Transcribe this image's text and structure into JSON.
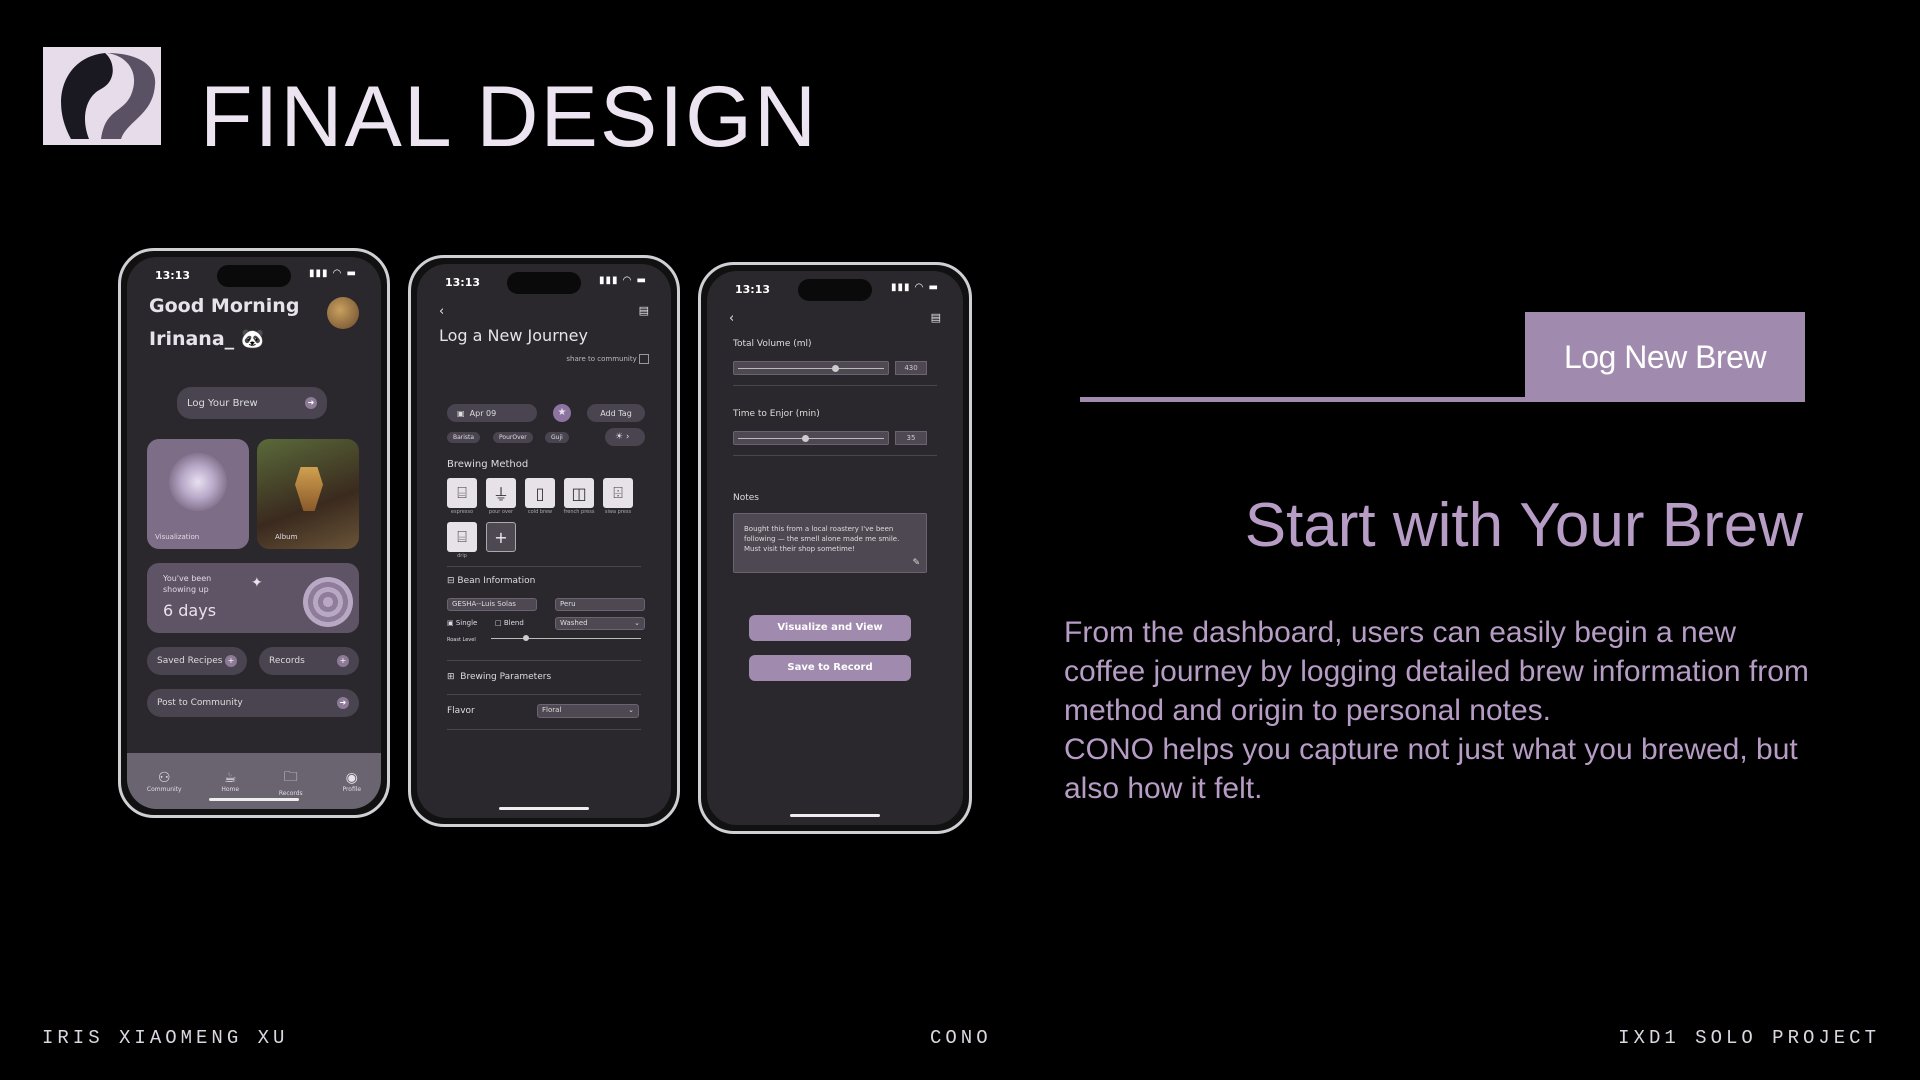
{
  "header": {
    "title": "FINAL DESIGN"
  },
  "phone1": {
    "time": "13:13",
    "greeting_line1": "Good Morning",
    "greeting_line2": "Irinana_",
    "log_button": "Log Your Brew",
    "card_visualization": "Visualization",
    "card_album": "Album",
    "streak_label": "You've been showing up",
    "streak_value": "6 days",
    "saved_recipes": "Saved Recipes",
    "records": "Records",
    "post_community": "Post to Community",
    "nav": [
      "Community",
      "Home",
      "Records",
      "Profile"
    ]
  },
  "phone2": {
    "time": "13:13",
    "title": "Log a New Journey",
    "share": "share to community",
    "date": "Apr 09",
    "add_tag": "Add Tag",
    "tags": [
      "Barista",
      "PourOver",
      "Guji"
    ],
    "brewing_method": "Brewing Method",
    "methods": [
      "espresso",
      "pour over",
      "cold brew",
      "french press",
      "siwa press",
      "drip"
    ],
    "bean_info": "Bean Information",
    "bean_name": "GESHA--Luis Solas",
    "origin": "Peru",
    "single": "Single",
    "blend": "Blend",
    "process": "Washed",
    "roast_level": "Roast Level",
    "brewing_params": "Brewing Parameters",
    "flavor": "Flavor",
    "flavor_value": "Floral"
  },
  "phone3": {
    "time": "13:13",
    "total_volume": "Total Volume (ml)",
    "total_volume_value": "430",
    "time_to_enjoy": "Time to Enjor (min)",
    "time_value": "35",
    "notes": "Notes",
    "notes_text": "Bought this from a local roastery I've been following — the smell alone made me smile. Must visit their shop sometime!",
    "visualize": "Visualize and View",
    "save": "Save to Record"
  },
  "right": {
    "tag": "Log New Brew",
    "headline": "Start with Your Brew",
    "body_line1": "From the dashboard, users can easily begin a new coffee journey by logging detailed brew information from method and origin to personal notes.",
    "body_line2": "CONO helps you capture not just what you brewed, but also how it felt."
  },
  "footer": {
    "left": "IRIS XIAOMENG XU",
    "center": "CONO",
    "right": "IXD1 SOLO PROJECT"
  },
  "colors": {
    "accent": "#a08aae",
    "background": "#000000",
    "screen": "#2a282c"
  }
}
